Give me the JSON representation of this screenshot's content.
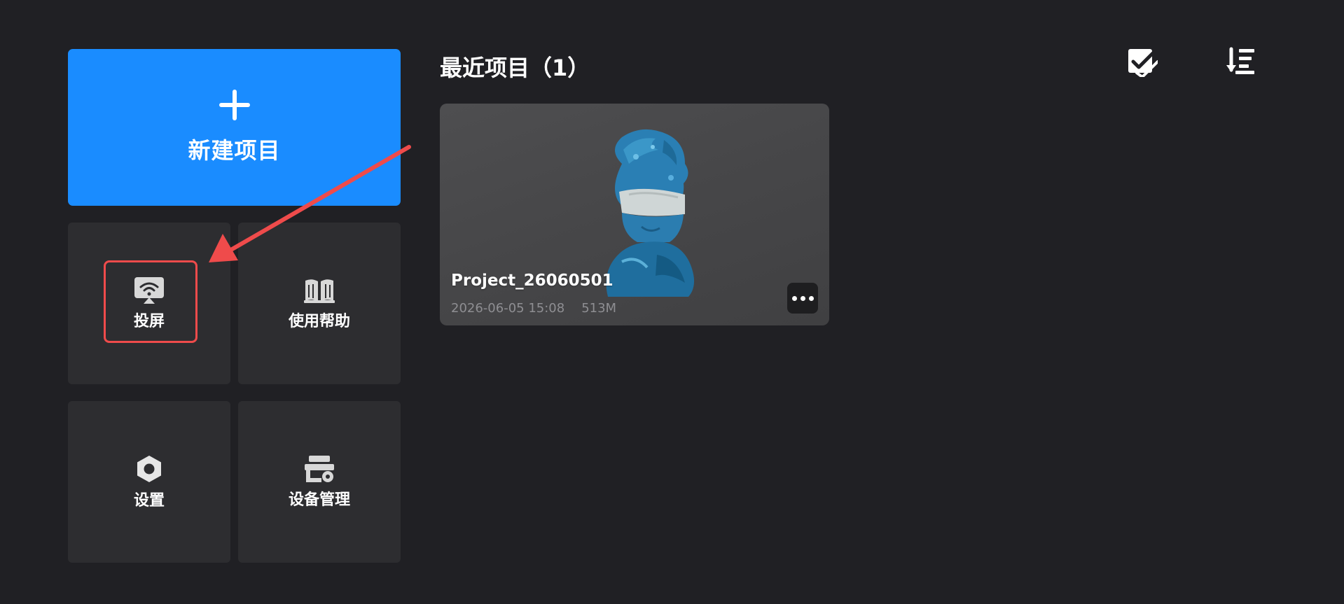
{
  "left_panel": {
    "new_project": {
      "label": "新建项目",
      "icon": "plus-icon"
    },
    "screen_cast": {
      "label": "投屏",
      "icon": "screen-cast-icon"
    },
    "help": {
      "label": "使用帮助",
      "icon": "book-icon"
    },
    "settings": {
      "label": "设置",
      "icon": "hex-nut-icon"
    },
    "device_management": {
      "label": "设备管理",
      "icon": "device-gear-icon"
    }
  },
  "recent": {
    "title": "最近项目（1）",
    "toolbar": {
      "select_icon": "multi-select-check-icon",
      "sort_icon": "sort-list-icon"
    },
    "projects": [
      {
        "name": "Project_26060501",
        "date": "2026-06-05 15:08",
        "size": "513M"
      }
    ]
  },
  "colors": {
    "background": "#202024",
    "tile": "#2d2d30",
    "accent": "#1a8cff",
    "annotation": "#ef4b4b",
    "meta_text": "#8e8e92"
  }
}
